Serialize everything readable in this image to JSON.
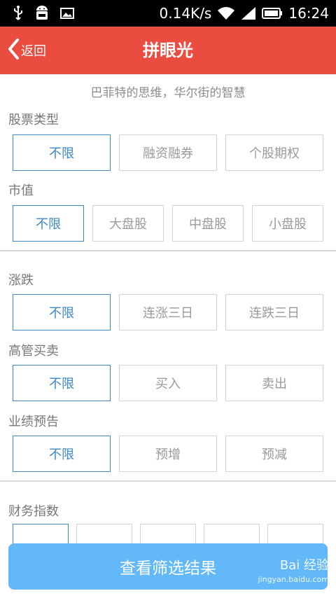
{
  "status_bar": {
    "icons": [
      "usb-icon",
      "android-icon",
      "image-icon"
    ],
    "speed": "0.14K/s",
    "time": "16:24"
  },
  "header": {
    "back_label": "返回",
    "title": "拼眼光"
  },
  "subtitle": "巴菲特的思维，华尔街的智慧",
  "sections": {
    "stock_type": {
      "label": "股票类型",
      "options": [
        "不限",
        "融资融券",
        "个股期权"
      ]
    },
    "market_cap": {
      "label": "市值",
      "options": [
        "不限",
        "大盘股",
        "中盘股",
        "小盘股"
      ]
    },
    "change": {
      "label": "涨跌",
      "options": [
        "不限",
        "连涨三日",
        "连跌三日"
      ]
    },
    "exec_trade": {
      "label": "高管买卖",
      "options": [
        "不限",
        "买入",
        "卖出"
      ]
    },
    "forecast": {
      "label": "业绩预告",
      "options": [
        "不限",
        "预增",
        "预减"
      ]
    },
    "financial": {
      "label": "财务指数"
    }
  },
  "bottom_button": "查看筛选结果",
  "watermark": {
    "brand": "Bai 经验",
    "url": "jingyan.baidu.com"
  },
  "colors": {
    "header": "#ea4d40",
    "selected": "#3d88c6",
    "button": "#63b8fa"
  }
}
